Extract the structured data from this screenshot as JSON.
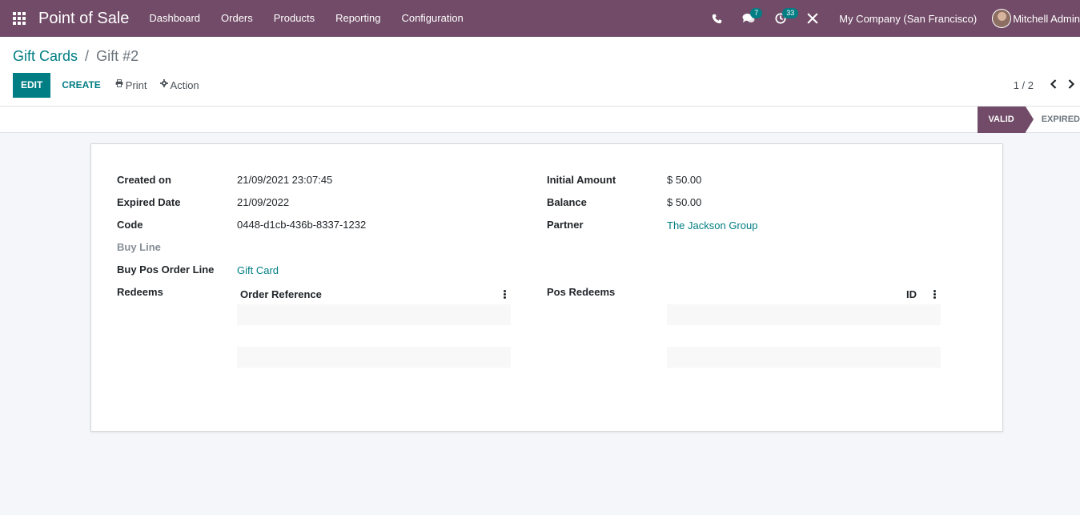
{
  "navbar": {
    "app_name": "Point of Sale",
    "menu": [
      "Dashboard",
      "Orders",
      "Products",
      "Reporting",
      "Configuration"
    ],
    "messages_count": "7",
    "activities_count": "33",
    "company": "My Company (San Francisco)",
    "user": "Mitchell Admin"
  },
  "breadcrumb": {
    "parent": "Gift Cards",
    "separator": "/",
    "current": "Gift #2"
  },
  "toolbar": {
    "edit_label": "EDIT",
    "create_label": "CREATE",
    "print_label": "Print",
    "action_label": "Action"
  },
  "pager": {
    "value": "1 / 2"
  },
  "status": {
    "stages": [
      "VALID",
      "EXPIRED"
    ],
    "active": "VALID"
  },
  "form": {
    "left": {
      "created_on_label": "Created on",
      "created_on_value": "21/09/2021 23:07:45",
      "expired_date_label": "Expired Date",
      "expired_date_value": "21/09/2022",
      "code_label": "Code",
      "code_value": "0448-d1cb-436b-8337-1232",
      "buy_line_label": "Buy Line",
      "buy_pos_order_line_label": "Buy Pos Order Line",
      "buy_pos_order_line_value": "Gift Card",
      "redeems_label": "Redeems",
      "redeems_column": "Order Reference"
    },
    "right": {
      "initial_amount_label": "Initial Amount",
      "initial_amount_value": "$ 50.00",
      "balance_label": "Balance",
      "balance_value": "$ 50.00",
      "partner_label": "Partner",
      "partner_value": "The Jackson Group",
      "pos_redeems_label": "Pos Redeems",
      "pos_redeems_column": "ID"
    }
  },
  "colors": {
    "brand": "#714b67",
    "accent": "#017e84"
  }
}
